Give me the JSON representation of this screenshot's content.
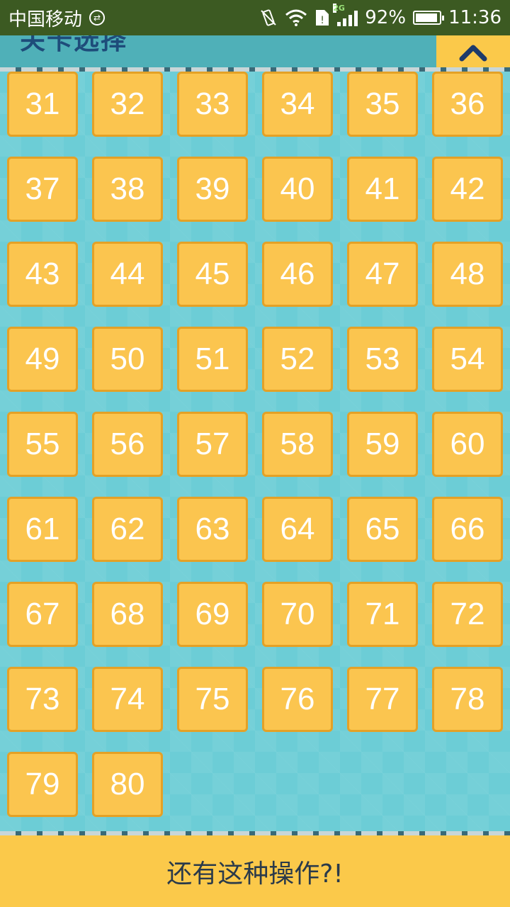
{
  "status_bar": {
    "carrier": "中国移动",
    "network_type": "2G",
    "battery": "92%",
    "battery_level": 0.92,
    "time": "11:36"
  },
  "header": {
    "title": "关卡选择",
    "collapse_icon": "chevron-up-icon"
  },
  "levels": [
    "31",
    "32",
    "33",
    "34",
    "35",
    "36",
    "37",
    "38",
    "39",
    "40",
    "41",
    "42",
    "43",
    "44",
    "45",
    "46",
    "47",
    "48",
    "49",
    "50",
    "51",
    "52",
    "53",
    "54",
    "55",
    "56",
    "57",
    "58",
    "59",
    "60",
    "61",
    "62",
    "63",
    "64",
    "65",
    "66",
    "67",
    "68",
    "69",
    "70",
    "71",
    "72",
    "73",
    "74",
    "75",
    "76",
    "77",
    "78",
    "79",
    "80"
  ],
  "bottom_button": {
    "label": "还有这种操作?!"
  },
  "colors": {
    "status_bar": "#3c5a22",
    "tile": "#fbc54f",
    "tile_border": "#e4a126",
    "background": "#6ccdd6",
    "accent": "#fbc94a",
    "title": "#1e4c7a"
  }
}
